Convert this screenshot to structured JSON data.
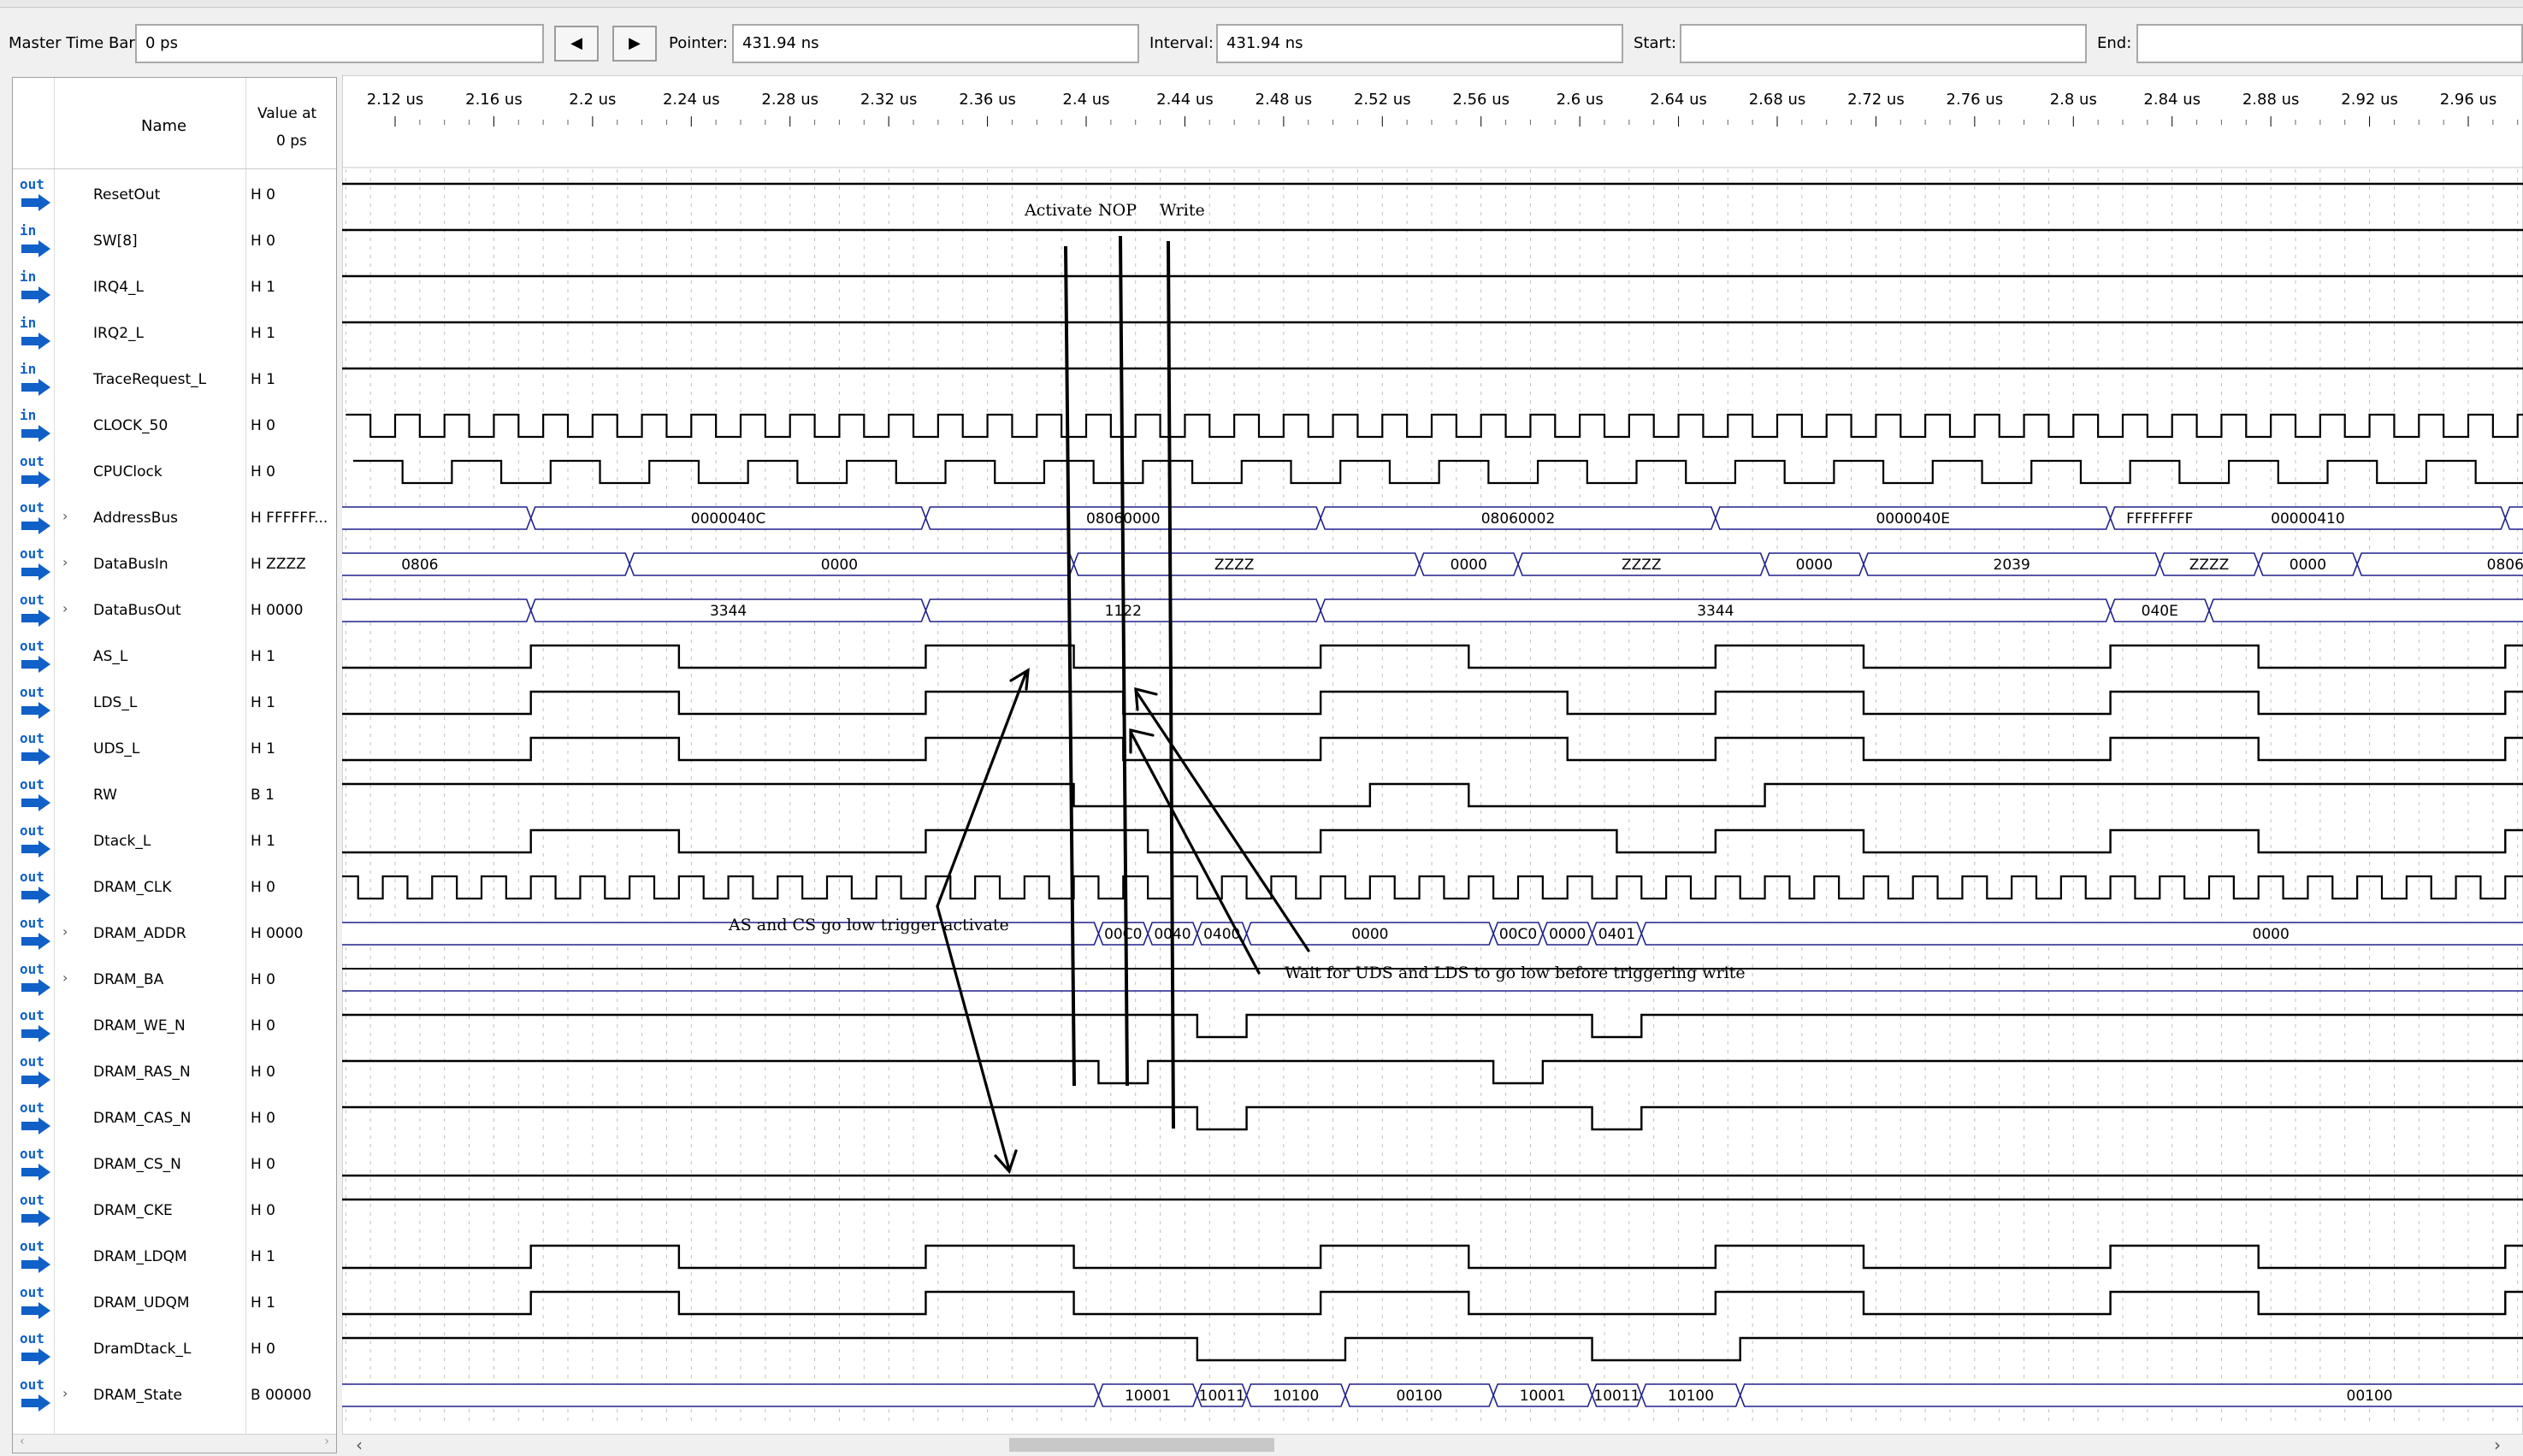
{
  "toolbar": {
    "master_label": "Master Time Bar:",
    "master_value": "0 ps",
    "prev_glyph": "◀",
    "next_glyph": "▶",
    "pointer_label": "Pointer:",
    "pointer_value": "431.94 ns",
    "interval_label": "Interval:",
    "interval_value": "431.94 ns",
    "start_label": "Start:",
    "start_value": "",
    "end_label": "End:",
    "end_value": ""
  },
  "columns": {
    "name": "Name",
    "value_line1": "Value at",
    "value_line2": "0 ps"
  },
  "timeline": {
    "ticks": [
      "2.12 us",
      "2.16 us",
      "2.2 us",
      "2.24 us",
      "2.28 us",
      "2.32 us",
      "2.36 us",
      "2.4 us",
      "2.44 us",
      "2.48 us",
      "2.52 us",
      "2.56 us",
      "2.6 us",
      "2.64 us",
      "2.68 us",
      "2.72 us",
      "2.76 us",
      "2.8 us",
      "2.84 us",
      "2.88 us",
      "2.92 us",
      "2.96 us"
    ]
  },
  "signals": [
    {
      "dir": "out",
      "name": "ResetOut",
      "value": "H 0",
      "bus": false
    },
    {
      "dir": "in",
      "name": "SW[8]",
      "value": "H 0",
      "bus": false
    },
    {
      "dir": "in",
      "name": "IRQ4_L",
      "value": "H 1",
      "bus": false
    },
    {
      "dir": "in",
      "name": "IRQ2_L",
      "value": "H 1",
      "bus": false
    },
    {
      "dir": "in",
      "name": "TraceRequest_L",
      "value": "H 1",
      "bus": false
    },
    {
      "dir": "in",
      "name": "CLOCK_50",
      "value": "H 0",
      "bus": false
    },
    {
      "dir": "out",
      "name": "CPUClock",
      "value": "H 0",
      "bus": false
    },
    {
      "dir": "out",
      "name": "AddressBus",
      "value": "H FFFFFF...",
      "bus": true
    },
    {
      "dir": "out",
      "name": "DataBusIn",
      "value": "H ZZZZ",
      "bus": true
    },
    {
      "dir": "out",
      "name": "DataBusOut",
      "value": "H 0000",
      "bus": true
    },
    {
      "dir": "out",
      "name": "AS_L",
      "value": "H 1",
      "bus": false
    },
    {
      "dir": "out",
      "name": "LDS_L",
      "value": "H 1",
      "bus": false
    },
    {
      "dir": "out",
      "name": "UDS_L",
      "value": "H 1",
      "bus": false
    },
    {
      "dir": "out",
      "name": "RW",
      "value": "B 1",
      "bus": false
    },
    {
      "dir": "out",
      "name": "Dtack_L",
      "value": "H 1",
      "bus": false
    },
    {
      "dir": "out",
      "name": "DRAM_CLK",
      "value": "H 0",
      "bus": false
    },
    {
      "dir": "out",
      "name": "DRAM_ADDR",
      "value": "H 0000",
      "bus": true
    },
    {
      "dir": "out",
      "name": "DRAM_BA",
      "value": "H 0",
      "bus": true
    },
    {
      "dir": "out",
      "name": "DRAM_WE_N",
      "value": "H 0",
      "bus": false
    },
    {
      "dir": "out",
      "name": "DRAM_RAS_N",
      "value": "H 0",
      "bus": false
    },
    {
      "dir": "out",
      "name": "DRAM_CAS_N",
      "value": "H 0",
      "bus": false
    },
    {
      "dir": "out",
      "name": "DRAM_CS_N",
      "value": "H 0",
      "bus": false
    },
    {
      "dir": "out",
      "name": "DRAM_CKE",
      "value": "H 0",
      "bus": false
    },
    {
      "dir": "out",
      "name": "DRAM_LDQM",
      "value": "H 1",
      "bus": false
    },
    {
      "dir": "out",
      "name": "DRAM_UDQM",
      "value": "H 1",
      "bus": false
    },
    {
      "dir": "out",
      "name": "DramDtack_L",
      "value": "H 0",
      "bus": false
    },
    {
      "dir": "out",
      "name": "DRAM_State",
      "value": "B 00000",
      "bus": true
    }
  ],
  "bus_labels": {
    "AddressBus": [
      "0000040C",
      "08060000",
      "08060002",
      "0000040E",
      "FFFFFFFF",
      "00000410"
    ],
    "DataBusIn": [
      "0806",
      "0000",
      "ZZZZ",
      "0000",
      "ZZZZ",
      "0000",
      "2039",
      "ZZZZ",
      "0000",
      "0806"
    ],
    "DataBusOut": [
      "3344",
      "1122",
      "3344",
      "040E"
    ],
    "DRAM_ADDR": [
      "00C0",
      "0040",
      "0400",
      "0000",
      "00C0",
      "0000",
      "0401",
      "0000"
    ],
    "DRAM_State": [
      "10001",
      "10011",
      "10100",
      "00100",
      "10001",
      "10011",
      "10100",
      "00100"
    ]
  },
  "annotations": {
    "activate": "Activate",
    "nop": "NOP",
    "write": "Write",
    "note_as_cs": "AS and CS go low trigger activate",
    "note_uds_lds": "Wait for UDS and LDS to go low before triggering write"
  },
  "colors": {
    "wave": "#000000",
    "bus_outline": "#20208c",
    "grid": "#c0c0c0",
    "io_icon": "#1060c8"
  }
}
